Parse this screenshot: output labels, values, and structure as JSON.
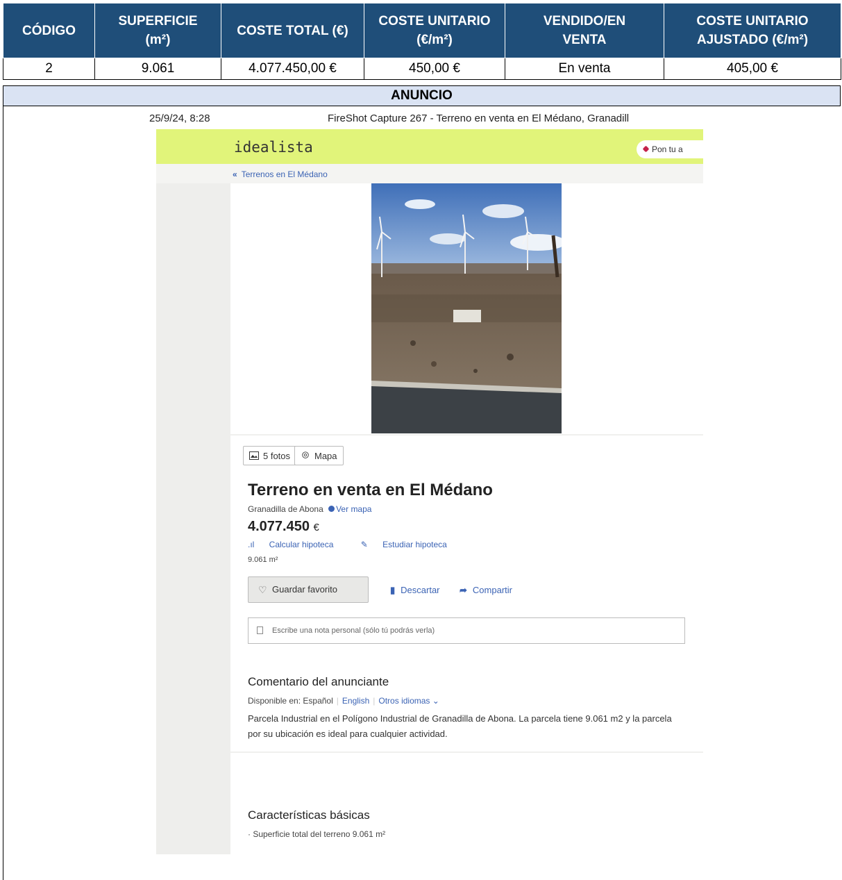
{
  "table": {
    "headers": [
      [
        "CÓDIGO"
      ],
      [
        "SUPERFICIE",
        "(m²)"
      ],
      [
        "COSTE TOTAL (€)"
      ],
      [
        "COSTE UNITARIO",
        "(€/m²)"
      ],
      [
        "VENDIDO/EN",
        "VENTA"
      ],
      [
        "COSTE UNITARIO",
        "AJUSTADO (€/m²)"
      ]
    ],
    "row": [
      "2",
      "9.061",
      "4.077.450,00 €",
      "450,00 €",
      "En venta",
      "405,00 €"
    ],
    "section_label": "ANUNCIO"
  },
  "screenshot": {
    "timestamp": "25/9/24, 8:28",
    "capture_title": "FireShot Capture 267 - Terreno en venta en El Médano, Granadill",
    "logo": "idealista",
    "pon_button": "Pon tu a",
    "back_link": "Terrenos en El Médano",
    "photos_button": "5 fotos",
    "map_button": "Mapa",
    "title": "Terreno en venta en El Médano",
    "location": "Granadilla de Abona",
    "see_map": "Ver mapa",
    "price": "4.077.450",
    "currency": "€",
    "calc_mortgage": "Calcular hipoteca",
    "study_mortgage": "Estudiar hipoteca",
    "area": "9.061 m²",
    "save_favorite": "Guardar favorito",
    "discard": "Descartar",
    "share": "Compartir",
    "note_placeholder": "Escribe una nota personal (sólo tú podrás verla)",
    "comment_heading": "Comentario del anunciante",
    "available_in": "Disponible en:",
    "lang_es": "Español",
    "lang_en": "English",
    "lang_other": "Otros idiomas",
    "description": "Parcela Industrial en el Polígono Industrial de Granadilla de Abona. La parcela tiene 9.061 m2 y la parcela por su ubicación es ideal para cualquier actividad.",
    "features_heading": "Características básicas",
    "feature_1": "· Superficie total del terreno 9.061 m²"
  },
  "colors": {
    "header_bg": "#1f4e79",
    "section_bg": "#dae3f3",
    "brand_bar": "#e1f47a",
    "link": "#3b63b4"
  }
}
